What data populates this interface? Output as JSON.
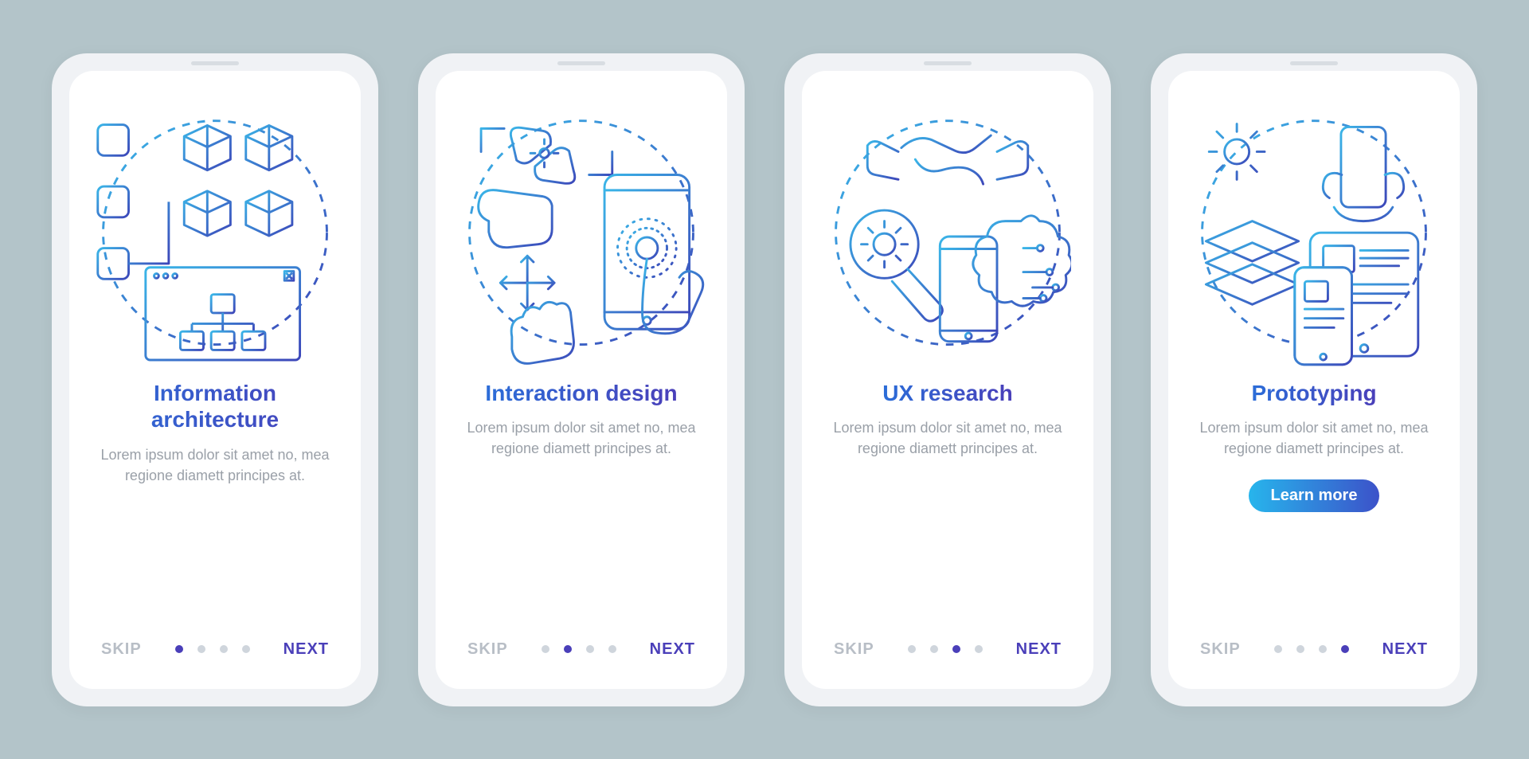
{
  "screens": [
    {
      "title": "Information architecture",
      "desc": "Lorem ipsum dolor sit amet no, mea regione diamett principes at.",
      "skip": "SKIP",
      "next": "NEXT",
      "activeDot": 0,
      "totalDots": 4,
      "icon": "info-arch-icon"
    },
    {
      "title": "Interaction design",
      "desc": "Lorem ipsum dolor sit amet no, mea regione diamett principes at.",
      "skip": "SKIP",
      "next": "NEXT",
      "activeDot": 1,
      "totalDots": 4,
      "icon": "interaction-icon"
    },
    {
      "title": "UX research",
      "desc": "Lorem ipsum dolor sit amet no, mea regione diamett principes at.",
      "skip": "SKIP",
      "next": "NEXT",
      "activeDot": 2,
      "totalDots": 4,
      "icon": "ux-research-icon"
    },
    {
      "title": "Prototyping",
      "desc": "Lorem ipsum dolor sit amet no, mea regione diamett principes at.",
      "cta": "Learn more",
      "skip": "SKIP",
      "next": "NEXT",
      "activeDot": 3,
      "totalDots": 4,
      "icon": "prototyping-icon"
    }
  ],
  "colors": {
    "grad_light": "#3ab6e8",
    "grad_dark": "#3c46b9"
  }
}
